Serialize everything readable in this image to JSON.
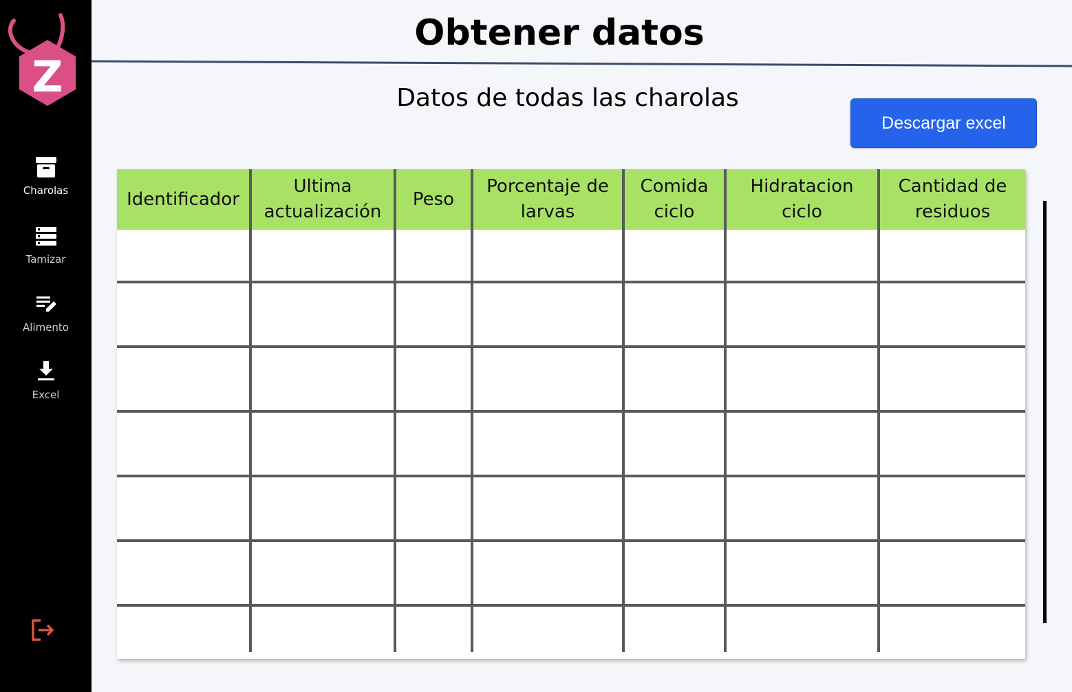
{
  "sidebar": {
    "logo_letter": "Z",
    "items": [
      {
        "label": "Charolas",
        "icon": "archive-box-icon",
        "active": true
      },
      {
        "label": "Tamizar",
        "icon": "server-stack-icon",
        "active": false
      },
      {
        "label": "Alimento",
        "icon": "list-edit-icon",
        "active": false
      },
      {
        "label": "Excel",
        "icon": "download-icon",
        "active": false
      }
    ],
    "logout_icon": "logout-icon"
  },
  "header": {
    "title": "Obtener datos"
  },
  "main": {
    "subtitle": "Datos de todas las charolas",
    "download_button": "Descargar excel",
    "table": {
      "columns": [
        "Identificador",
        "Ultima actualización",
        "Peso",
        "Porcentaje de larvas",
        "Comida ciclo",
        "Hidratacion ciclo",
        "Cantidad de residuos"
      ]
    }
  },
  "colors": {
    "sidebar_bg": "#000000",
    "accent": "#2563eb",
    "header_row": "#a8e265",
    "logo": "#d94f86"
  }
}
